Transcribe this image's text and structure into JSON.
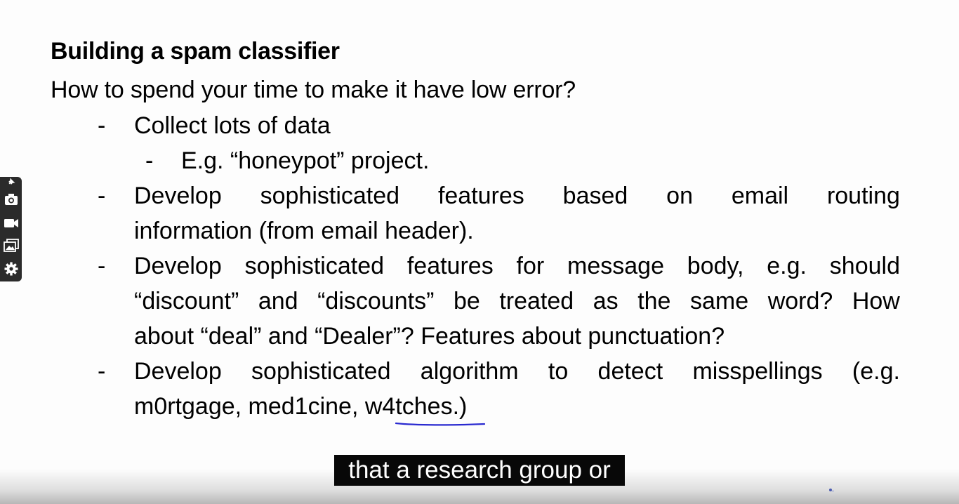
{
  "slide": {
    "title": "Building a spam classifier",
    "subtitle": "How to spend your time to make it have low error?",
    "bullet_marker": "-",
    "bullets": [
      {
        "text": "Collect lots of data"
      },
      {
        "text": "E.g. “honeypot” project."
      },
      {
        "line1_words": [
          "Develop",
          "sophisticated",
          "features",
          "based",
          "on",
          "email",
          "routing"
        ],
        "line2": "information (from email header)."
      },
      {
        "line1_words": [
          "Develop",
          "sophisticated",
          "features",
          "for",
          "message",
          "body,",
          "e.g.",
          "should"
        ],
        "line2_words": [
          "“discount”",
          "and",
          "“discounts”",
          "be",
          "treated",
          "as",
          "the",
          "same",
          "word?",
          "How"
        ],
        "line3": "about “deal” and “Dealer”? Features about punctuation?"
      },
      {
        "line1_words": [
          "Develop",
          "sophisticated",
          "algorithm",
          "to",
          "detect",
          "misspellings",
          "(e.g."
        ],
        "line2": "m0rtgage, med1cine, w4tches.)"
      }
    ]
  },
  "caption": {
    "text": "that a research group or"
  },
  "toolbar": {
    "icons": [
      "pin-icon",
      "camera-icon",
      "video-icon",
      "gallery-icon",
      "settings-icon"
    ]
  },
  "colors": {
    "underline": "#2a2ad0",
    "toolbar_bg": "#2b2b2b",
    "caption_bg": "#080808"
  }
}
